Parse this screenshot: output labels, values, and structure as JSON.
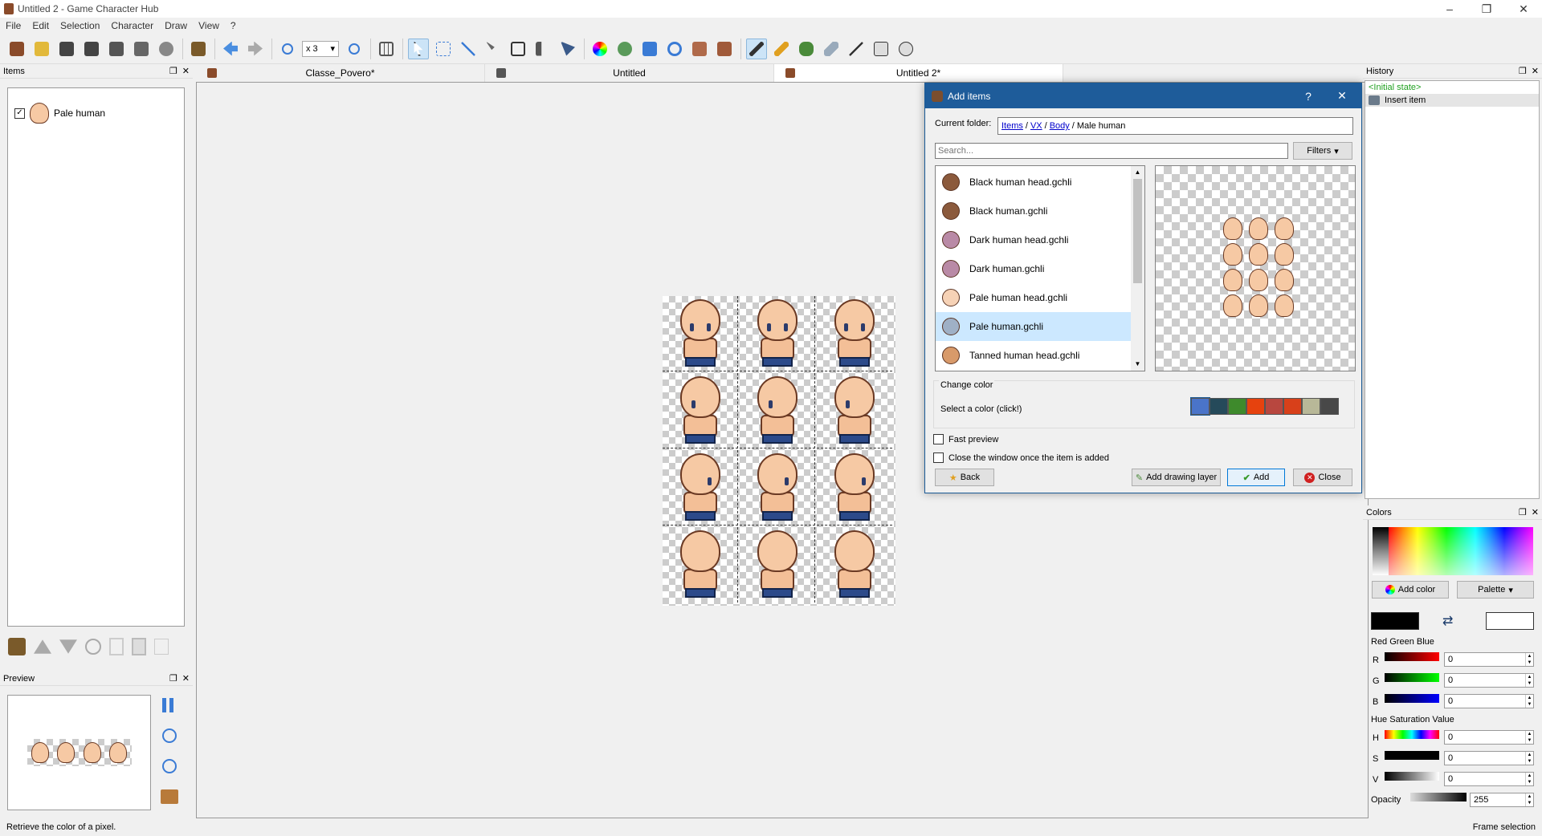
{
  "window": {
    "title": "Untitled 2 - Game Character Hub",
    "controls": [
      "–",
      "❐",
      "✕"
    ]
  },
  "menu": [
    "File",
    "Edit",
    "Selection",
    "Character",
    "Draw",
    "View",
    "?"
  ],
  "toolbar": {
    "zoom": "x 3"
  },
  "items_panel": {
    "title": "Items",
    "items": [
      {
        "label": "Pale human",
        "checked": true
      }
    ]
  },
  "preview_panel": {
    "title": "Preview"
  },
  "tabs": [
    {
      "label": "Classe_Povero*"
    },
    {
      "label": "Untitled"
    },
    {
      "label": "Untitled 2*",
      "active": true
    }
  ],
  "dialog": {
    "title": "Add items",
    "help": "?",
    "close_glyph": "✕",
    "current_folder_label": "Current folder:",
    "breadcrumb": {
      "items": "Items",
      "sep": "/",
      "vx": "VX",
      "body": "Body",
      "current": "Male human"
    },
    "search_placeholder": "Search...",
    "filters": "Filters",
    "files": [
      {
        "name": "Black human head.gchli",
        "color": "#8b5a3c"
      },
      {
        "name": "Black human.gchli",
        "color": "#8b5a3c"
      },
      {
        "name": "Dark human head.gchli",
        "color": "#b98aa6"
      },
      {
        "name": "Dark human.gchli",
        "color": "#b98aa6"
      },
      {
        "name": "Pale human head.gchli",
        "color": "#f6d2b6"
      },
      {
        "name": "Pale human.gchli",
        "color": "#9fb0c6",
        "selected": true
      },
      {
        "name": "Tanned human head.gchli",
        "color": "#d89a6a"
      }
    ],
    "change_color_title": "Change color",
    "select_color_label": "Select a color (click!)",
    "swatches": [
      "#4a74c9",
      "#254a5a",
      "#3e8a2c",
      "#e6420e",
      "#b8473f",
      "#d8401a",
      "#b8b898",
      "#484848"
    ],
    "fast_preview": "Fast preview",
    "close_once_added": "Close the window once the item is added",
    "back": "Back",
    "add_drawing_layer": "Add drawing layer",
    "add": "Add",
    "close": "Close"
  },
  "history_panel": {
    "title": "History",
    "entries": [
      {
        "label": "<Initial state>"
      },
      {
        "label": "Insert item",
        "selected": true
      }
    ]
  },
  "colors_panel": {
    "title": "Colors",
    "add_color": "Add color",
    "palette": "Palette",
    "primary_color": "#000000",
    "secondary_color": "#ffffff",
    "rgb_title": "Red Green Blue",
    "r_label": "R",
    "r_value": "0",
    "g_label": "G",
    "g_value": "0",
    "b_label": "B",
    "b_value": "0",
    "hsv_title": "Hue Saturation Value",
    "h_label": "H",
    "h_value": "0",
    "s_label": "S",
    "s_value": "0",
    "v_label": "V",
    "v_value": "0",
    "opacity_label": "Opacity",
    "opacity_value": "255"
  },
  "status": {
    "left": "Retrieve the color of a pixel.",
    "right": "Frame selection"
  }
}
